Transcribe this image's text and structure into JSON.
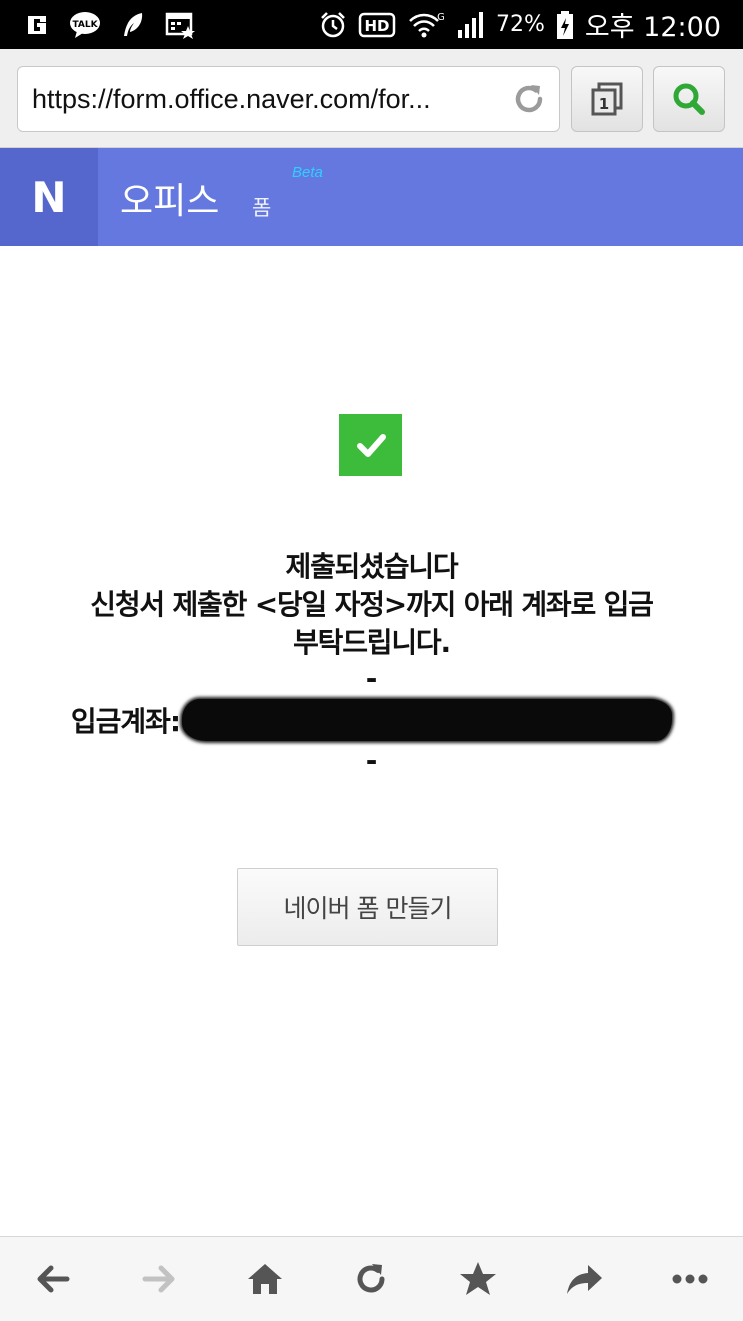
{
  "status_bar": {
    "icons_left": [
      "g-icon",
      "talk-icon",
      "feather-icon",
      "calendar-icon"
    ],
    "hd_label": "HD",
    "network_label": "G",
    "battery": "72%",
    "time": "오후 12:00"
  },
  "browser": {
    "url": "https://form.office.naver.com/for...",
    "tab_count": "1"
  },
  "header": {
    "logo": "N",
    "title": "오피스",
    "subtitle": "폼",
    "beta": "Beta"
  },
  "content": {
    "line1": "제출되셨습니다",
    "line2": "신청서 제출한 <당일 자정>까지 아래 계좌로 입금",
    "line3": "부탁드립니다.",
    "dash1": "-",
    "account_label": "입금계좌:",
    "dash2": "-",
    "button_label": "네이버 폼 만들기"
  },
  "colors": {
    "header": "#6478df",
    "logo_bg": "#5567cc",
    "check": "#3dbb3a",
    "search_icon": "#2fa836"
  },
  "bottom_nav": [
    "back-icon",
    "forward-icon",
    "home-icon",
    "reload-icon",
    "star-icon",
    "share-icon",
    "more-icon"
  ]
}
